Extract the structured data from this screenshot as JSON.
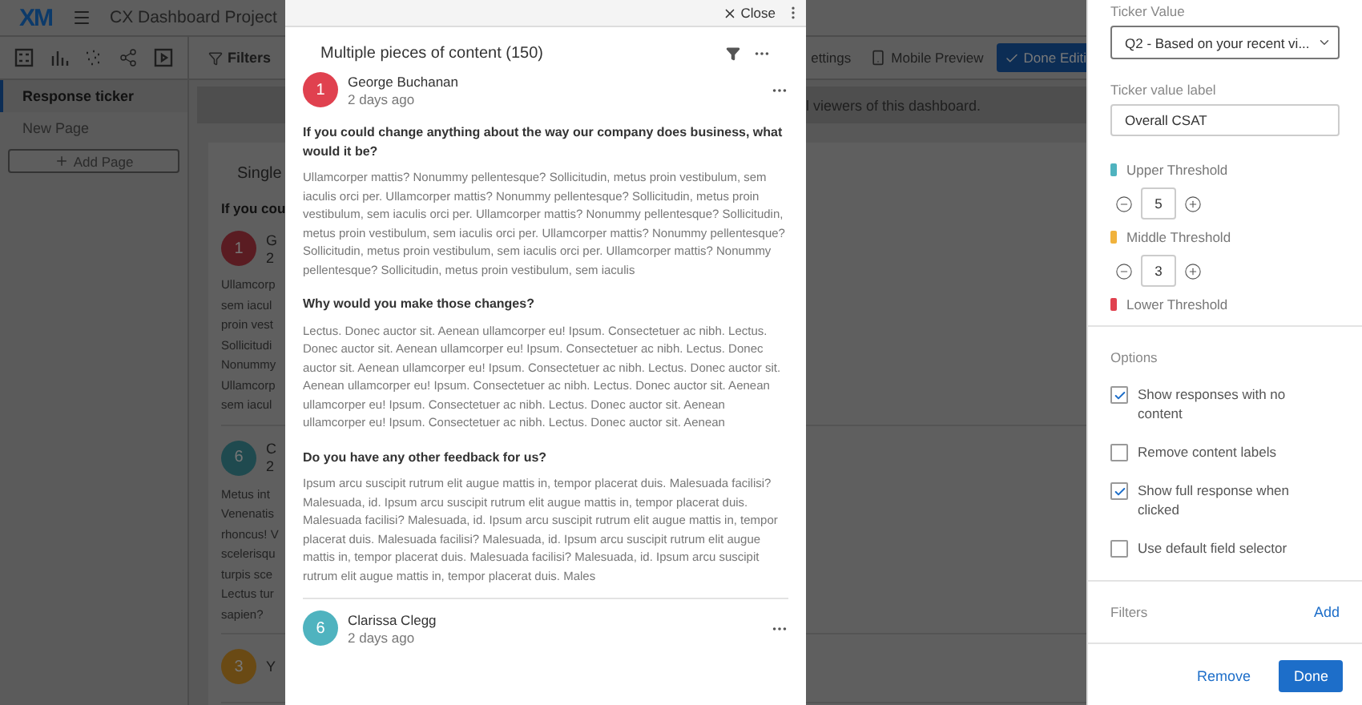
{
  "app": {
    "logo": "XM",
    "title": "CX Dashboard Project"
  },
  "toolbar": {
    "filters": "Filters",
    "settings": "ettings",
    "mobile_preview": "Mobile Preview",
    "done": "Done Editi"
  },
  "sidebar": {
    "pages": [
      {
        "label": "Response ticker",
        "selected": true
      },
      {
        "label": "New Page",
        "selected": false
      }
    ],
    "add_page": "Add Page"
  },
  "banner": "l viewers of this dashboard.",
  "background_card": {
    "title": "Single",
    "question": "If you cou",
    "responses": [
      {
        "badge": "1",
        "color": "#5a1c22",
        "name": "G",
        "time": "2",
        "lines": [
          "Ullamcorp",
          "sem iacul",
          "proin vest",
          "Sollicitudi",
          "Nonummy",
          "Ullamcorp",
          "sem iacul"
        ]
      },
      {
        "badge": "6",
        "color": "#1f4a4f",
        "name": "C",
        "time": "2",
        "lines": [
          "Metus int",
          "Venenatis",
          "rhoncus! V",
          "scelerisqu",
          "turpis sce",
          "Lectus tur",
          "sapien?"
        ]
      },
      {
        "badge": "3",
        "color": "#6a4a14",
        "name": "Y"
      }
    ]
  },
  "modal": {
    "close": "Close",
    "title": "Multiple pieces of content (150)",
    "responses": [
      {
        "badge": "1",
        "color": "#e0414f",
        "name": "George Buchanan",
        "time": "2 days ago",
        "answers": [
          {
            "question": "If you could change anything about the way our company does business, what would it be?",
            "answer": "Ullamcorper mattis? Nonummy pellentesque? Sollicitudin, metus proin vestibulum, sem iaculis orci per. Ullamcorper mattis? Nonummy pellentesque? Sollicitudin, metus proin vestibulum, sem iaculis orci per. Ullamcorper mattis? Nonummy pellentesque? Sollicitudin, metus proin vestibulum, sem iaculis orci per. Ullamcorper mattis? Nonummy pellentesque? Sollicitudin, metus proin vestibulum, sem iaculis orci per. Ullamcorper mattis? Nonummy pellentesque? Sollicitudin, metus proin vestibulum, sem iaculis"
          },
          {
            "question": "Why would you make those changes?",
            "answer": "Lectus. Donec auctor sit. Aenean ullamcorper eu! Ipsum. Consectetuer ac nibh. Lectus. Donec auctor sit. Aenean ullamcorper eu! Ipsum. Consectetuer ac nibh. Lectus. Donec auctor sit. Aenean ullamcorper eu! Ipsum. Consectetuer ac nibh. Lectus. Donec auctor sit. Aenean ullamcorper eu! Ipsum. Consectetuer ac nibh. Lectus. Donec auctor sit. Aenean ullamcorper eu! Ipsum. Consectetuer ac nibh. Lectus. Donec auctor sit. Aenean ullamcorper eu! Ipsum. Consectetuer ac nibh. Lectus. Donec auctor sit. Aenean"
          },
          {
            "question": "Do you have any other feedback for us?",
            "answer": "Ipsum arcu suscipit rutrum elit augue mattis in, tempor placerat duis. Malesuada facilisi? Malesuada, id. Ipsum arcu suscipit rutrum elit augue mattis in, tempor placerat duis. Malesuada facilisi? Malesuada, id. Ipsum arcu suscipit rutrum elit augue mattis in, tempor placerat duis. Malesuada facilisi? Malesuada, id. Ipsum arcu suscipit rutrum elit augue mattis in, tempor placerat duis. Malesuada facilisi? Malesuada, id. Ipsum arcu suscipit rutrum elit augue mattis in, tempor placerat duis. Males"
          }
        ]
      },
      {
        "badge": "6",
        "color": "#4fb3bf",
        "name": "Clarissa Clegg",
        "time": "2 days ago"
      }
    ]
  },
  "panel": {
    "ticker_value": {
      "label": "Ticker Value",
      "value": "Q2 - Based on your recent vi..."
    },
    "ticker_label": {
      "label": "Ticker value label",
      "value": "Overall CSAT"
    },
    "thresholds": [
      {
        "label": "Upper Threshold",
        "color": "#4fb3bf",
        "value": "5"
      },
      {
        "label": "Middle Threshold",
        "color": "#f0b23c",
        "value": "3"
      },
      {
        "label": "Lower Threshold",
        "color": "#e0414f"
      }
    ],
    "options": {
      "title": "Options",
      "items": [
        {
          "label": "Show responses with no content",
          "checked": true
        },
        {
          "label": "Remove content labels",
          "checked": false
        },
        {
          "label": "Show full response when clicked",
          "checked": true
        },
        {
          "label": "Use default field selector",
          "checked": false
        }
      ]
    },
    "filters": {
      "title": "Filters",
      "action": "Add"
    },
    "buttons": {
      "remove": "Remove",
      "done": "Done"
    }
  }
}
